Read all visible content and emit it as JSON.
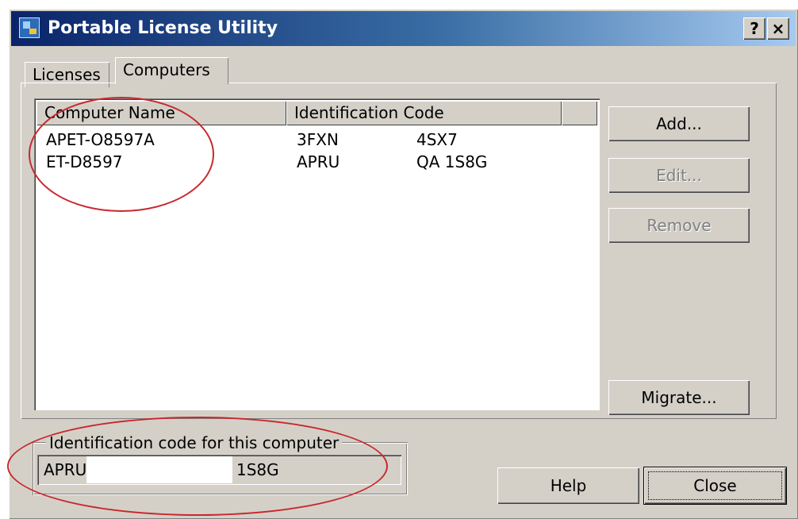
{
  "window": {
    "title": "Portable License Utility",
    "title_help_glyph": "?",
    "title_close_glyph": "×"
  },
  "tabs": [
    {
      "label": "Licenses",
      "selected": false
    },
    {
      "label": "Computers",
      "selected": true
    }
  ],
  "list": {
    "columns": [
      "Computer Name",
      "Identification Code"
    ],
    "rows": [
      {
        "name": "APET-O8597A",
        "code_part1": "3FXN",
        "code_part2": "4SX7"
      },
      {
        "name": "ET-D8597",
        "code_part1": "APRU",
        "code_part2": "QA 1S8G"
      }
    ]
  },
  "buttons": {
    "add": {
      "label": "Add...",
      "enabled": true
    },
    "edit": {
      "label": "Edit...",
      "enabled": false
    },
    "remove": {
      "label": "Remove",
      "enabled": false
    },
    "migrate": {
      "label": "Migrate...",
      "enabled": true
    },
    "help": {
      "label": "Help",
      "enabled": true
    },
    "close": {
      "label": "Close",
      "enabled": true
    }
  },
  "id_group": {
    "label": "Identification code for this computer",
    "code_part1": "APRU",
    "code_part2": "1S8G"
  },
  "colors": {
    "title_gradient_start": "#0a246a",
    "title_gradient_end": "#a6caf0",
    "dialog_face": "#d4d0c8",
    "annotation_red": "#c8282d"
  }
}
